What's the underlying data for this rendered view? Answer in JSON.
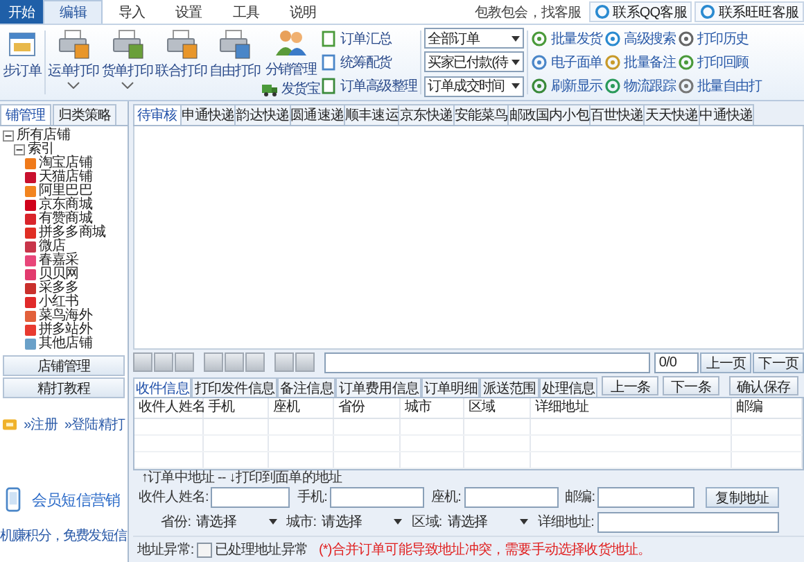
{
  "menu": [
    {
      "label": "开始",
      "kind": "app",
      "selected": false
    },
    {
      "label": "编辑",
      "kind": "tab",
      "selected": true
    },
    {
      "label": "导入",
      "kind": "tab",
      "selected": false
    },
    {
      "label": "设置",
      "kind": "tab",
      "selected": false
    },
    {
      "label": "工具",
      "kind": "tab",
      "selected": false
    },
    {
      "label": "说明",
      "kind": "tab",
      "selected": false
    }
  ],
  "support": {
    "text": "包教包会，找客服",
    "buttons": [
      "联系QQ客服",
      "联系旺旺客服"
    ]
  },
  "ribbon": {
    "sync": "步订单",
    "print_buttons": [
      {
        "label": "运单打印",
        "dropdown": true
      },
      {
        "label": "货单打印",
        "dropdown": true
      },
      {
        "label": "联合打印",
        "dropdown": false
      },
      {
        "label": "自由打印",
        "dropdown": false
      }
    ],
    "distribution": {
      "label": "分销管理",
      "sub": "发货宝"
    },
    "order_tools": [
      "订单汇总",
      "统筹配货",
      "订单高级整理"
    ],
    "filters": [
      "全部订单",
      "买家已付款(待",
      "订单成交时间"
    ],
    "columns": [
      [
        "批量发货",
        "电子面单",
        "刷新显示"
      ],
      [
        "高级搜索",
        "批量备注",
        "物流跟踪"
      ],
      [
        "打印历史",
        "打印回顾",
        "批量自由打"
      ]
    ]
  },
  "left": {
    "tabs": [
      {
        "label": "铺管理",
        "selected": true
      },
      {
        "label": "归类策略",
        "selected": false
      }
    ],
    "tree": [
      {
        "label": "所有店铺",
        "expanded": true,
        "children": [
          {
            "label": "索引",
            "expanded": true,
            "children": [
              {
                "label": "淘宝店铺",
                "color": "#f07a1a"
              },
              {
                "label": "天猫店铺",
                "color": "#c8102e"
              },
              {
                "label": "阿里巴巴",
                "color": "#f2841f"
              },
              {
                "label": "京东商城",
                "color": "#d0021b"
              },
              {
                "label": "有赞商城",
                "color": "#d9252b"
              },
              {
                "label": "拼多多商城",
                "color": "#e02e24"
              },
              {
                "label": "微店",
                "color": "#c8354a"
              },
              {
                "label": "春嘉采",
                "color": "#e8467a"
              },
              {
                "label": "贝贝网",
                "color": "#e23a6e"
              },
              {
                "label": "采多多",
                "color": "#c9302c"
              },
              {
                "label": "小红书",
                "color": "#e02a2a"
              },
              {
                "label": "菜鸟海外",
                "color": "#e2603b"
              },
              {
                "label": "拼多站外",
                "color": "#e83a30"
              },
              {
                "label": "其他店铺",
                "color": "#6aa0c8"
              }
            ]
          }
        ]
      }
    ],
    "buttons": [
      "店铺管理",
      "精打教程"
    ],
    "links": [
      "»注册",
      "»登陆精打"
    ],
    "promo_title": "会员短信营销",
    "promo_text": "机赚积分，免费发短信"
  },
  "express_tabs": [
    {
      "label": "待审核",
      "selected": true
    },
    {
      "label": "申通快递",
      "selected": false
    },
    {
      "label": "韵达快递",
      "selected": false
    },
    {
      "label": "圆通速递",
      "selected": false
    },
    {
      "label": "顺丰速运",
      "selected": false
    },
    {
      "label": "京东快递",
      "selected": false
    },
    {
      "label": "安能菜鸟",
      "selected": false
    },
    {
      "label": "邮政国内小包",
      "selected": false
    },
    {
      "label": "百世快递",
      "selected": false
    },
    {
      "label": "天天快递",
      "selected": false
    },
    {
      "label": "中通快递",
      "selected": false
    }
  ],
  "pager": {
    "count": "0/0",
    "prev": "上一页",
    "next": "下一页"
  },
  "detail_tabs": [
    {
      "label": "收件信息",
      "selected": true
    },
    {
      "label": "打印发件信息",
      "selected": false
    },
    {
      "label": "备注信息",
      "selected": false
    },
    {
      "label": "订单费用信息",
      "selected": false
    },
    {
      "label": "订单明细",
      "selected": false
    },
    {
      "label": "派送范围",
      "selected": false
    },
    {
      "label": "处理信息",
      "selected": false
    }
  ],
  "detail_buttons": [
    "上一条",
    "下一条",
    "确认保存"
  ],
  "grid_columns": [
    "收件人姓名",
    "手机",
    "座机",
    "省份",
    "城市",
    "区域",
    "详细地址",
    "邮编"
  ],
  "address_note": "↑订单中地址 -- ↓打印到面单的地址",
  "form_rows": [
    [
      {
        "kind": "input",
        "label": "收件人姓名:"
      },
      {
        "kind": "input",
        "label": "手机:"
      },
      {
        "kind": "input",
        "label": "座机:"
      },
      {
        "kind": "input",
        "label": "邮编:"
      },
      {
        "kind": "button",
        "label": "复制地址"
      }
    ],
    [
      {
        "kind": "select",
        "label": "省份:",
        "value": "请选择"
      },
      {
        "kind": "select",
        "label": "城市:",
        "value": "请选择"
      },
      {
        "kind": "select",
        "label": "区域:",
        "value": "请选择"
      },
      {
        "kind": "input",
        "label": "详细地址:"
      }
    ]
  ],
  "anomaly": {
    "label": "地址异常:",
    "checkbox": "已处理地址异常",
    "checked": false,
    "warning": "(*)合并订单可能导致地址冲突，需要手动选择收货地址。"
  }
}
